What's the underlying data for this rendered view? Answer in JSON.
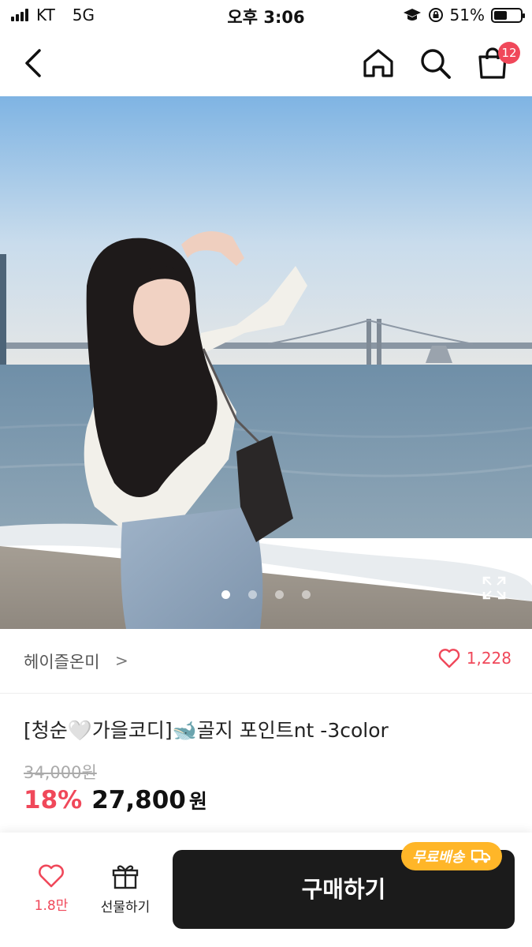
{
  "status_bar": {
    "carrier": "KT",
    "network": "5G",
    "time": "오후 3:06",
    "battery": "51%"
  },
  "nav": {
    "cart_count": "12"
  },
  "gallery": {
    "dot_count": 4,
    "active_index": 0
  },
  "seller": {
    "name": "헤이즐온미",
    "likes": "1,228"
  },
  "product": {
    "title": "[청순🤍가을코디]🐋골지 포인트nt -3color",
    "original_price": "34,000원",
    "discount": "18%",
    "price": "27,800",
    "currency": "원"
  },
  "bottom_bar": {
    "wish_count": "1.8만",
    "gift_label": "선물하기",
    "buy_label": "구매하기",
    "shipping_badge": "무료배송"
  },
  "colors": {
    "accent": "#f0485a",
    "buy_button": "#1b1b1b",
    "shipping_badge": "#ffb628"
  }
}
